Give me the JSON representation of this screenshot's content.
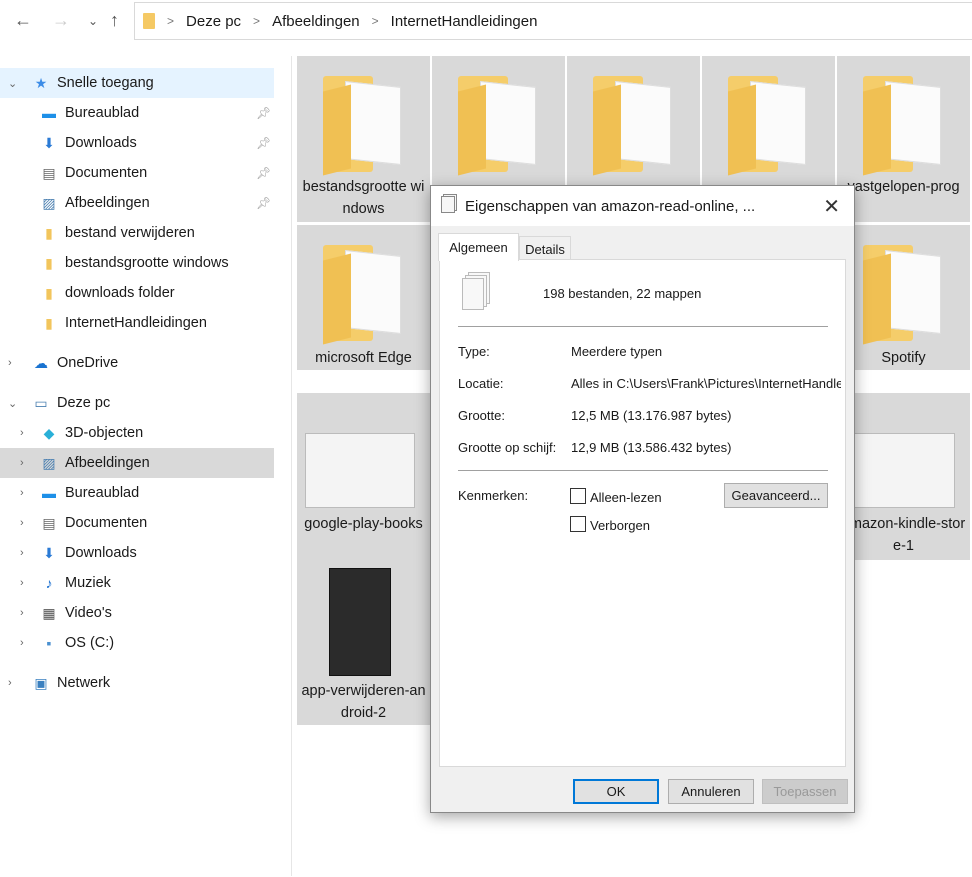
{
  "toolbar": {
    "back_icon": "arrow-left",
    "forward_icon": "arrow-right",
    "recent_icon": "chevron-down",
    "up_icon": "arrow-up"
  },
  "breadcrumb": [
    "Deze pc",
    "Afbeeldingen",
    "InternetHandleidingen"
  ],
  "sidebar": {
    "items": [
      {
        "label": "Snelle toegang",
        "icon": "star",
        "level": 0,
        "chev": "⌄",
        "state": "sel1"
      },
      {
        "label": "Bureaublad",
        "icon": "desktop",
        "level": 1,
        "pin": true
      },
      {
        "label": "Downloads",
        "icon": "download",
        "level": 1,
        "pin": true
      },
      {
        "label": "Documenten",
        "icon": "document",
        "level": 1,
        "pin": true
      },
      {
        "label": "Afbeeldingen",
        "icon": "picture",
        "level": 1,
        "pin": true
      },
      {
        "label": "bestand verwijderen",
        "icon": "folder",
        "level": 1
      },
      {
        "label": "bestandsgrootte windows",
        "icon": "folder",
        "level": 1
      },
      {
        "label": "downloads folder",
        "icon": "folder",
        "level": 1
      },
      {
        "label": "InternetHandleidingen",
        "icon": "folder",
        "level": 1
      },
      {
        "label": "OneDrive",
        "icon": "cloud",
        "level": 0,
        "chev": "›",
        "gap": true
      },
      {
        "label": "Deze pc",
        "icon": "computer",
        "level": 0,
        "chev": "⌄",
        "gap": true
      },
      {
        "label": "3D-objecten",
        "icon": "cube",
        "level": 1,
        "chev": "›"
      },
      {
        "label": "Afbeeldingen",
        "icon": "picture",
        "level": 1,
        "chev": "›",
        "state": "sel2"
      },
      {
        "label": "Bureaublad",
        "icon": "desktop",
        "level": 1,
        "chev": "›"
      },
      {
        "label": "Documenten",
        "icon": "document",
        "level": 1,
        "chev": "›"
      },
      {
        "label": "Downloads",
        "icon": "download",
        "level": 1,
        "chev": "›"
      },
      {
        "label": "Muziek",
        "icon": "music",
        "level": 1,
        "chev": "›"
      },
      {
        "label": "Video's",
        "icon": "video",
        "level": 1,
        "chev": "›"
      },
      {
        "label": "OS (C:)",
        "icon": "drive",
        "level": 1,
        "chev": "›"
      },
      {
        "label": "Netwerk",
        "icon": "network",
        "level": 0,
        "chev": "›",
        "gap": true
      }
    ]
  },
  "files": {
    "rows": [
      {
        "kind": "folder",
        "items": [
          "bestandsgrootte windows",
          null,
          null,
          null,
          "vastgelopen-prog"
        ]
      },
      {
        "kind": "folder",
        "items": [
          "microsoft Edge",
          null,
          null,
          null,
          "Spotify"
        ]
      },
      {
        "kind": "image",
        "items": [
          "google-play-books",
          null,
          null,
          null,
          "amazon-kindle-store-1"
        ]
      },
      {
        "kind": "image",
        "items": [
          "app-verwijderen-android-2"
        ]
      }
    ]
  },
  "dialog": {
    "title": "Eigenschappen van amazon-read-online, ...",
    "tabs": [
      "Algemeen",
      "Details"
    ],
    "summary": "198 bestanden, 22 mappen",
    "props": [
      {
        "label": "Type:",
        "value": "Meerdere typen"
      },
      {
        "label": "Locatie:",
        "value": "Alles in C:\\Users\\Frank\\Pictures\\InternetHandleidingen"
      },
      {
        "label": "Grootte:",
        "value": "12,5 MB (13.176.987 bytes)"
      },
      {
        "label": "Grootte op schijf:",
        "value": "12,9 MB (13.586.432 bytes)"
      }
    ],
    "attributes_label": "Kenmerken:",
    "readonly_label": "Alleen-lezen",
    "hidden_label": "Verborgen",
    "advanced_button": "Geavanceerd...",
    "ok_button": "OK",
    "cancel_button": "Annuleren",
    "apply_button": "Toepassen"
  }
}
